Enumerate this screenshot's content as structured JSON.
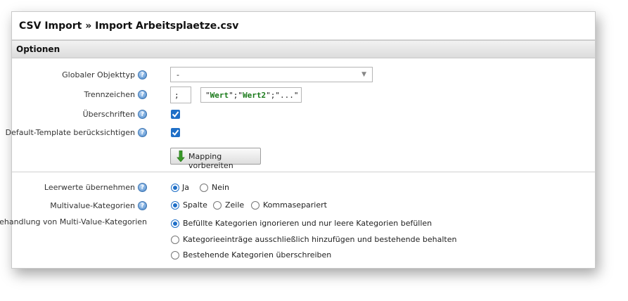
{
  "window": {
    "title": "CSV Import » Import Arbeitsplaetze.csv"
  },
  "section": {
    "title": "Optionen"
  },
  "fields": {
    "objekttyp": {
      "label": "Globaler Objekttyp",
      "value": "-"
    },
    "trennzeichen": {
      "label": "Trennzeichen",
      "value": ";",
      "example_q1": "\"",
      "example_w1": "Wert",
      "example_mid": "\";\"",
      "example_w2": "Wert2",
      "example_end": "\";\"...\""
    },
    "ueberschriften": {
      "label": "Überschriften",
      "checked": true
    },
    "default_template": {
      "label": "Default-Template berücksichtigen",
      "checked": true
    },
    "mapping_button": {
      "label": "Mapping vorbereiten"
    },
    "leerwerte": {
      "label": "Leerwerte übernehmen",
      "options": [
        "Ja",
        "Nein"
      ],
      "selected": "Ja"
    },
    "multivalue": {
      "label": "Multivalue-Kategorien",
      "options": [
        "Spalte",
        "Zeile",
        "Kommasepariert"
      ],
      "selected": "Spalte"
    },
    "behandlung": {
      "label": "Behandlung von Multi-Value-Kategorien",
      "options": [
        "Befüllte Kategorien ignorieren und nur leere Kategorien befüllen",
        "Kategorieeinträge ausschließlich hinzufügen und bestehende behalten",
        "Bestehende Kategorien überschreiben"
      ],
      "selected_index": 0
    }
  },
  "icons": {
    "help": "help-icon",
    "dropdown": "dropdown-arrow-icon",
    "mapping": "green-down-arrow-icon",
    "check": "checkmark-icon"
  },
  "colors": {
    "accent": "#1f6fc7",
    "arrow_green": "#3a9a2a",
    "example_green": "#1a7a1a"
  }
}
